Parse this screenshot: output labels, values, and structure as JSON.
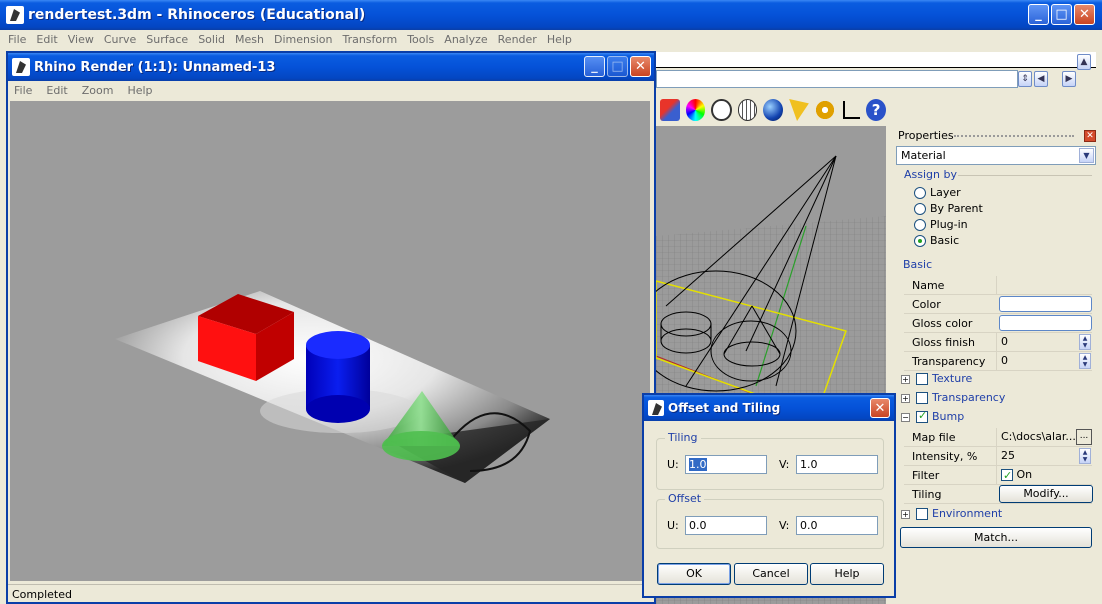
{
  "main_window": {
    "title": "rendertest.3dm - Rhinoceros (Educational)",
    "menu": [
      "File",
      "Edit",
      "View",
      "Curve",
      "Surface",
      "Solid",
      "Mesh",
      "Dimension",
      "Transform",
      "Tools",
      "Analyze",
      "Render",
      "Help"
    ]
  },
  "render_window": {
    "title": "Rhino Render (1:1): Unnamed-13",
    "menu": [
      "File",
      "Edit",
      "Zoom",
      "Help"
    ],
    "status": "Completed"
  },
  "properties": {
    "header": "Properties",
    "type_select": "Material",
    "assign_by_label": "Assign by",
    "assign_options": [
      "Layer",
      "By Parent",
      "Plug-in",
      "Basic"
    ],
    "assign_selected": "Basic",
    "basic_label": "Basic",
    "fields": {
      "name": {
        "label": "Name",
        "value": ""
      },
      "color": {
        "label": "Color"
      },
      "gloss_color": {
        "label": "Gloss color"
      },
      "gloss_finish": {
        "label": "Gloss finish",
        "value": "0"
      },
      "transparency": {
        "label": "Transparency",
        "value": "0"
      }
    },
    "sections": {
      "texture": "Texture",
      "transparency": "Transparency",
      "bump": "Bump",
      "environment": "Environment"
    },
    "bump": {
      "map_file_label": "Map file",
      "map_file_value": "C:\\docs\\alar...",
      "intensity_label": "Intensity, %",
      "intensity_value": "25",
      "filter_label": "Filter",
      "filter_value": "On",
      "tiling_label": "Tiling",
      "tiling_button": "Modify..."
    },
    "match_button": "Match..."
  },
  "dialog": {
    "title": "Offset and Tiling",
    "tiling_legend": "Tiling",
    "offset_legend": "Offset",
    "u_label": "U:",
    "v_label": "V:",
    "tiling_u": "1.0",
    "tiling_v": "1.0",
    "offset_u": "0.0",
    "offset_v": "0.0",
    "ok": "OK",
    "cancel": "Cancel",
    "help": "Help"
  },
  "colors": {
    "xp_blue": "#0552d8",
    "chrome": "#ece9d8",
    "red_box": "#e00000",
    "blue_cylinder": "#0000e0",
    "green_cone": "#44c044"
  }
}
